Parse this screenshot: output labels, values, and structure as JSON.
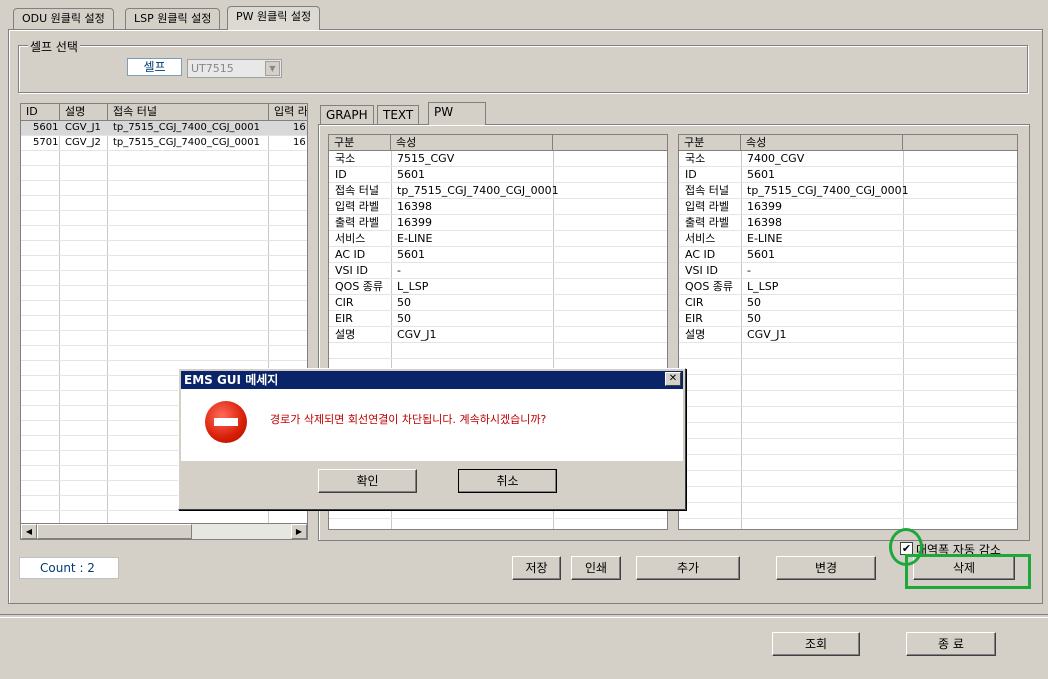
{
  "top_tabs": [
    "ODU 원클릭 설정",
    "LSP 원클릭 설정",
    "PW 원클릭 설정"
  ],
  "cell_select": {
    "group_label": "셀프 선택",
    "label": "셀프",
    "combo_value": "UT7515"
  },
  "list": {
    "columns": [
      "ID",
      "설명",
      "접속 터널",
      "입력 라"
    ],
    "rows": [
      [
        "5601",
        "CGV_J1",
        "tp_7515_CGJ_7400_CGJ_0001",
        "16"
      ],
      [
        "5701",
        "CGV_J2",
        "tp_7515_CGJ_7400_CGJ_0001",
        "16"
      ]
    ]
  },
  "inner_tabs": [
    "GRAPH",
    "TEXT",
    "PW"
  ],
  "grid_left": {
    "columns": [
      "구분",
      "속성"
    ],
    "rows": [
      [
        "국소",
        "7515_CGV"
      ],
      [
        "ID",
        "5601"
      ],
      [
        "접속 터널",
        "tp_7515_CGJ_7400_CGJ_0001"
      ],
      [
        "입력 라벨",
        "16398"
      ],
      [
        "출력 라벨",
        "16399"
      ],
      [
        "서비스",
        "E-LINE"
      ],
      [
        "AC ID",
        "5601"
      ],
      [
        "VSI ID",
        "-"
      ],
      [
        "QOS 종류",
        "L_LSP"
      ],
      [
        "CIR",
        "50"
      ],
      [
        "EIR",
        "50"
      ],
      [
        "설명",
        "CGV_J1"
      ]
    ]
  },
  "grid_right": {
    "columns": [
      "구분",
      "속성"
    ],
    "rows": [
      [
        "국소",
        "7400_CGV"
      ],
      [
        "ID",
        "5601"
      ],
      [
        "접속 터널",
        "tp_7515_CGJ_7400_CGJ_0001"
      ],
      [
        "입력 라벨",
        "16399"
      ],
      [
        "출력 라벨",
        "16398"
      ],
      [
        "서비스",
        "E-LINE"
      ],
      [
        "AC ID",
        "5601"
      ],
      [
        "VSI ID",
        "-"
      ],
      [
        "QOS 종류",
        "L_LSP"
      ],
      [
        "CIR",
        "50"
      ],
      [
        "EIR",
        "50"
      ],
      [
        "설명",
        "CGV_J1"
      ]
    ]
  },
  "checkbox": {
    "label": "대역폭 자동 감소",
    "checked": true,
    "mark": "✔"
  },
  "count_label": "Count : 2",
  "buttons": {
    "save": "저장",
    "print": "인쇄",
    "add": "추가",
    "modify": "변경",
    "delete": "삭제",
    "query": "조회",
    "exit": "종 료"
  },
  "dialog": {
    "title": "EMS GUI 메세지",
    "message": "경로가 삭제되면 회선연결이 차단됩니다. 계속하시겠습니까?",
    "ok": "확인",
    "cancel": "취소"
  },
  "colors": {
    "highlight": "#1fa83a",
    "titlebar": "#0a246a",
    "message": "#c00000"
  }
}
